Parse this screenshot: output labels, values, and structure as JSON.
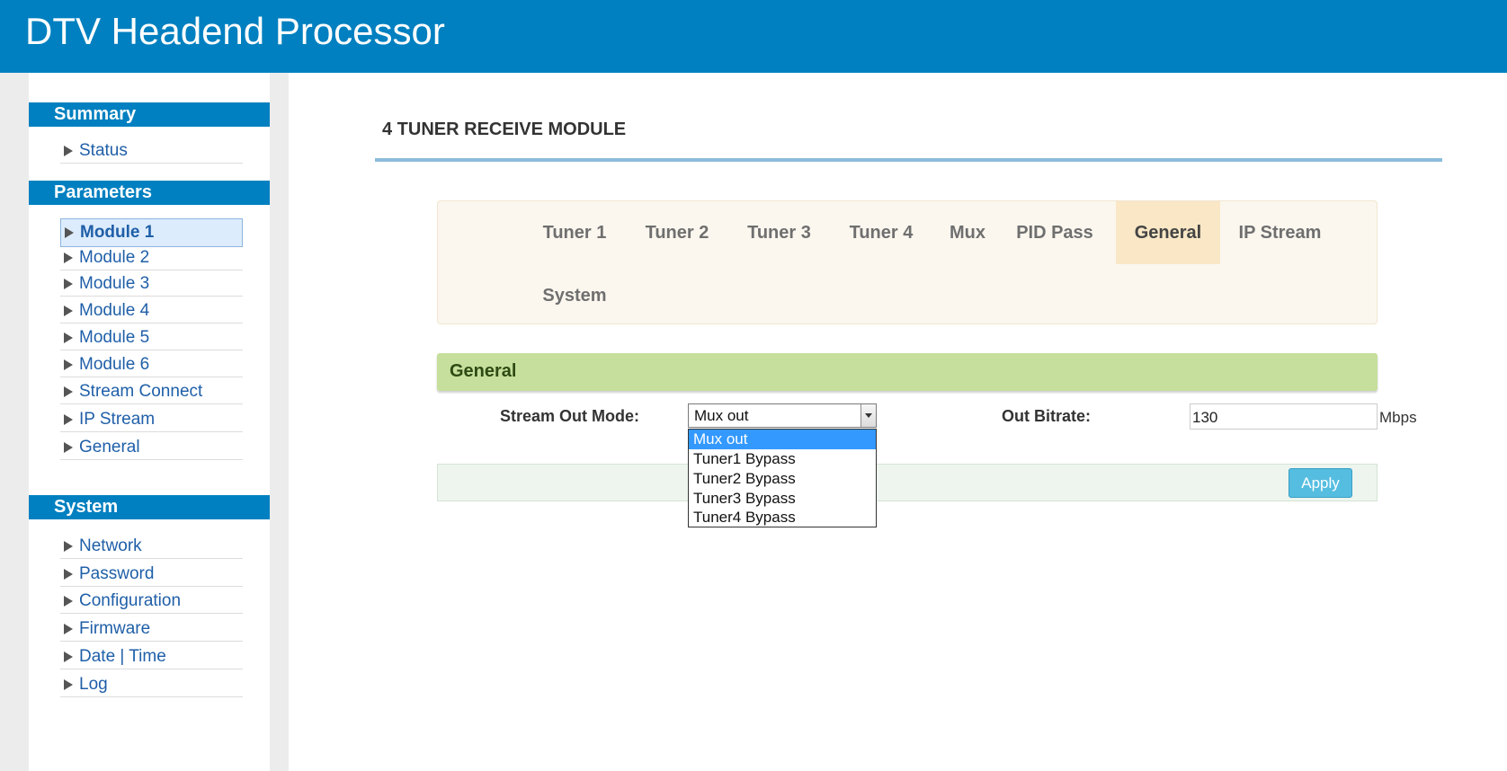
{
  "header": {
    "title": "DTV Headend Processor"
  },
  "sidebar": {
    "sections": [
      {
        "title": "Summary",
        "items": [
          {
            "label": "Status"
          }
        ]
      },
      {
        "title": "Parameters",
        "items": [
          {
            "label": "Module 1",
            "active": true
          },
          {
            "label": "Module 2"
          },
          {
            "label": "Module 3"
          },
          {
            "label": "Module 4"
          },
          {
            "label": "Module 5"
          },
          {
            "label": "Module 6"
          },
          {
            "label": "Stream Connect"
          },
          {
            "label": "IP Stream"
          },
          {
            "label": "General"
          }
        ]
      },
      {
        "title": "System",
        "items": [
          {
            "label": "Network"
          },
          {
            "label": "Password"
          },
          {
            "label": "Configuration"
          },
          {
            "label": "Firmware"
          },
          {
            "label": "Date | Time"
          },
          {
            "label": "Log"
          }
        ]
      }
    ]
  },
  "main": {
    "page_title": "4 TUNER RECEIVE MODULE",
    "tabs": [
      {
        "label": "Tuner 1"
      },
      {
        "label": "Tuner 2"
      },
      {
        "label": "Tuner 3"
      },
      {
        "label": "Tuner 4"
      },
      {
        "label": "Mux"
      },
      {
        "label": "PID Pass"
      },
      {
        "label": "General",
        "active": true
      },
      {
        "label": "IP Stream"
      },
      {
        "label": "System"
      }
    ],
    "section_title": "General",
    "stream_out_mode": {
      "label": "Stream Out Mode:",
      "value": "Mux out",
      "options": [
        "Mux out",
        "Tuner1 Bypass",
        "Tuner2 Bypass",
        "Tuner3 Bypass",
        "Tuner4 Bypass"
      ]
    },
    "out_bitrate": {
      "label": "Out Bitrate:",
      "value": "130",
      "unit": "Mbps"
    },
    "apply_label": "Apply"
  },
  "colors": {
    "header_blue": "#0080c0",
    "section_green": "#c6df9c",
    "tab_active": "#f9e7c5",
    "link_blue": "#1f5fa8",
    "apply_button": "#55bde0",
    "dropdown_selected": "#3399ff"
  },
  "icons": {
    "sidebar_bullet": "triangle-right-icon",
    "select_arrow": "chevron-down-icon"
  }
}
